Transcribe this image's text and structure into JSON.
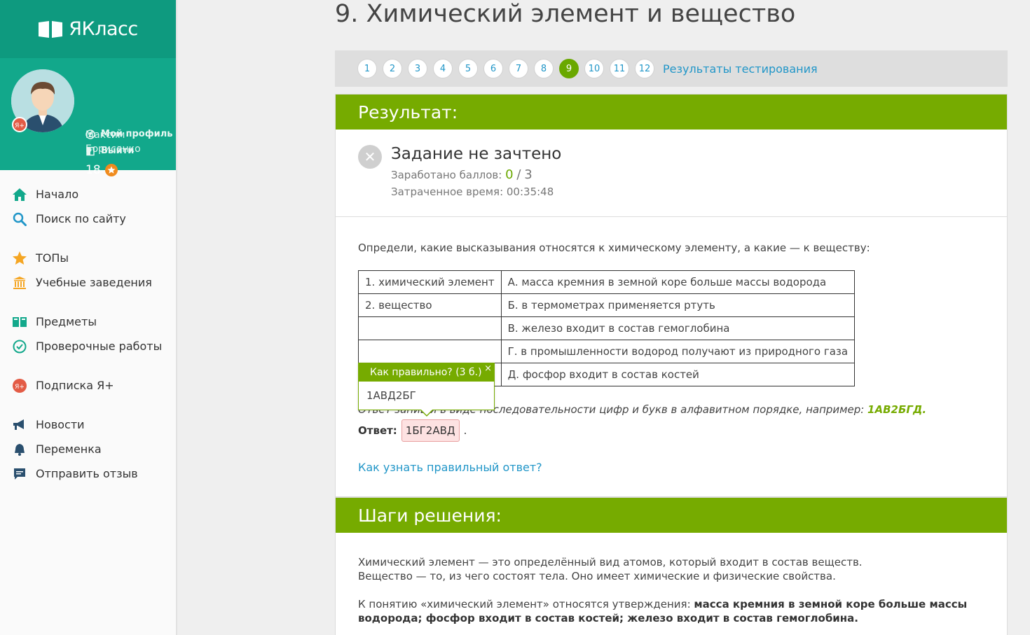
{
  "logo": {
    "text": "ЯКласс"
  },
  "user": {
    "name": "Максим Борисенко",
    "points": "18",
    "profile_link": "Мой профиль",
    "logout_link": "Выйти"
  },
  "nav": [
    {
      "label": "Начало",
      "icon": "home-icon"
    },
    {
      "label": "Поиск по сайту",
      "icon": "search-icon"
    },
    {
      "label": "ТОПы",
      "icon": "star-icon"
    },
    {
      "label": "Учебные заведения",
      "icon": "institution-icon"
    },
    {
      "label": "Предметы",
      "icon": "books-icon"
    },
    {
      "label": "Проверочные работы",
      "icon": "check-circle-icon"
    },
    {
      "label": "Подписка Я+",
      "icon": "subscription-icon"
    },
    {
      "label": "Новости",
      "icon": "megaphone-icon"
    },
    {
      "label": "Переменка",
      "icon": "bell-icon"
    },
    {
      "label": "Отправить отзыв",
      "icon": "feedback-icon"
    }
  ],
  "page_title": "9. Химический элемент и вещество",
  "question_nav": {
    "numbers": [
      "1",
      "2",
      "3",
      "4",
      "5",
      "6",
      "7",
      "8",
      "9",
      "10",
      "11",
      "12"
    ],
    "active": "9",
    "results_link": "Результаты тестирования"
  },
  "result": {
    "heading": "Результат:",
    "status_title": "Задание не зачтено",
    "score_label": "Заработано баллов:",
    "score_value": "0",
    "score_sep": "/",
    "score_total": "3",
    "time_label": "Затраченное время: 00:35:48"
  },
  "question": {
    "text": "Определи, какие высказывания относятся к химическому элементу, а какие — к веществу:",
    "table": [
      [
        "1. химический элемент",
        "А. масса кремния в земной коре больше массы водорода"
      ],
      [
        "2. вещество",
        "Б. в термометрах применяется ртуть"
      ],
      [
        "",
        "В. железо входит в состав гемоглобина"
      ],
      [
        "",
        "Г. в промышленности водород получают из природного газа"
      ],
      [
        "",
        "Д. фосфор входит в состав костей"
      ]
    ],
    "hint_prefix": "Ответ запиши в виде последовательности цифр и букв в алфавитном порядке, например:",
    "hint_example": "1АВ2БГД",
    "hint_suffix": ".",
    "answer_label": "Ответ:",
    "answer_value": "1БГ2АВД",
    "answer_suffix": ".",
    "how_link": "Как узнать правильный ответ?"
  },
  "popup": {
    "title": "Как правильно? (3 б.)",
    "close": "×",
    "correct": "1АВД2БГ"
  },
  "steps": {
    "heading": "Шаги решения:",
    "line1": "Химический элемент — это определённый вид атомов, который входит в состав веществ.",
    "line2": "Вещество — то, из чего состоят тела. Оно имеет химические и физические свойства.",
    "line3_prefix": "К понятию «химический элемент» относятся утверждения:",
    "line3_bold": "масса кремния в земной коре больше массы водорода; фосфор входит в состав костей; железо входит в состав гемоглобина."
  },
  "colors": {
    "brand_teal": "#0e9a7f",
    "accent_green": "#76ab00",
    "link_blue": "#2196c8",
    "error_bg": "#fde2e2"
  }
}
